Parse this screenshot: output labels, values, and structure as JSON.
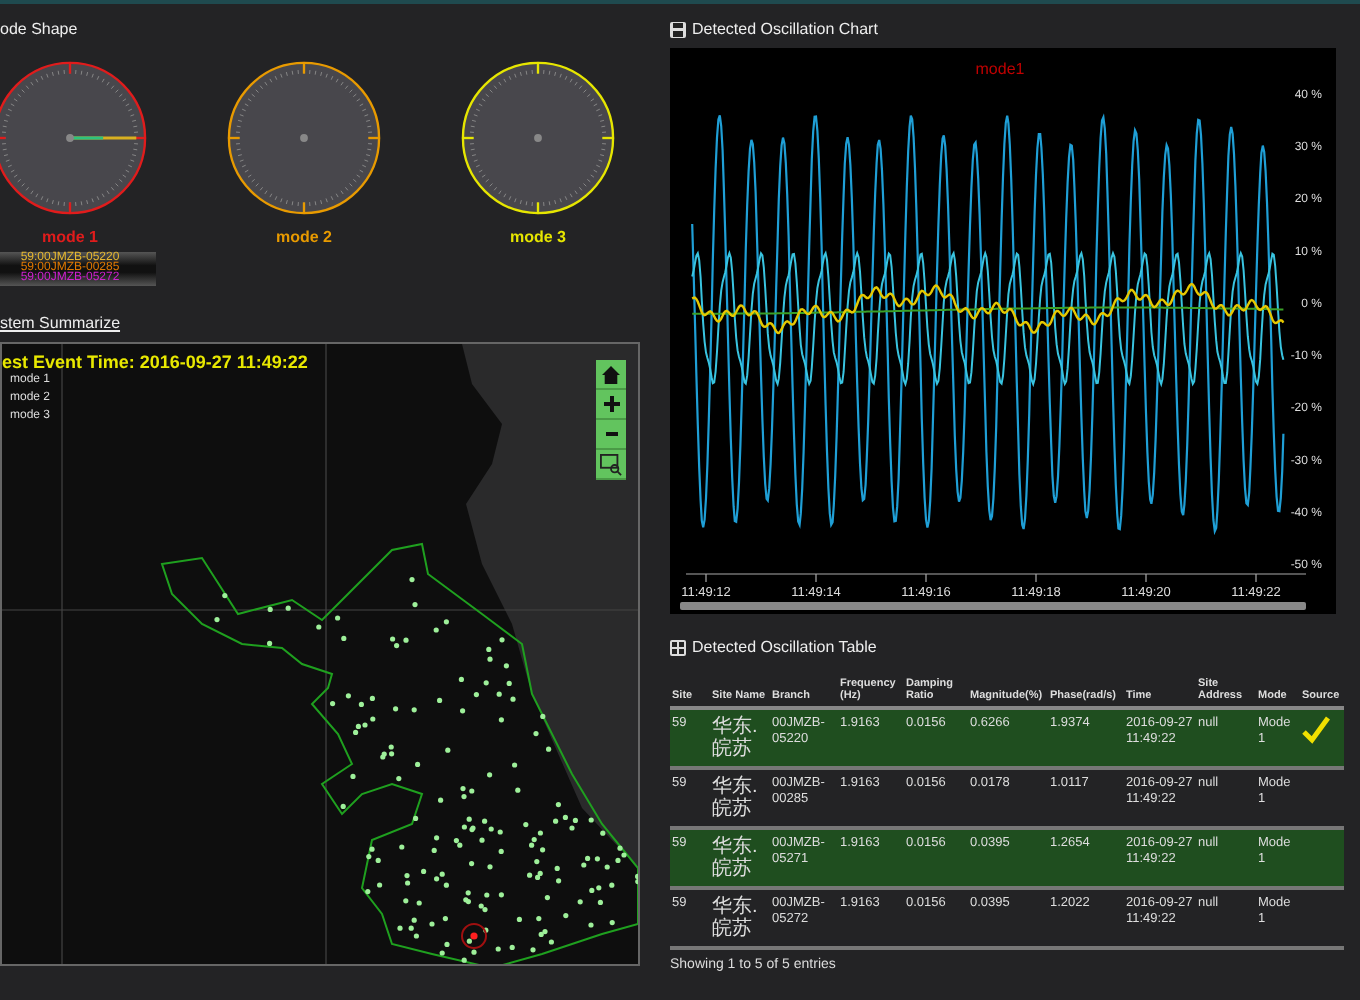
{
  "mode_shape": {
    "title": "ode Shape",
    "gauges": [
      {
        "label": "mode 1",
        "color": "#e01c1c",
        "needles": true
      },
      {
        "label": "mode 2",
        "color": "#e89a00",
        "needles": false
      },
      {
        "label": "mode 3",
        "color": "#e6e600",
        "needles": false
      }
    ],
    "legend": [
      {
        "label": "59:00JMZB-05220",
        "color": "#e8b830"
      },
      {
        "label": "59:00JMZB-00285",
        "color": "#e07800"
      },
      {
        "label": "59:00JMZB-05272",
        "color": "#d020d0"
      }
    ]
  },
  "system_summary": {
    "title": "stem Summarize",
    "event_time": "est Event Time: 2016-09-27 11:49:22",
    "legend": [
      "mode 1",
      "mode 2",
      "mode 3"
    ]
  },
  "chart": {
    "title": "Detected Oscillation Chart",
    "series_label": "mode1",
    "yticks": [
      "40 %",
      "30 %",
      "20 %",
      "10 %",
      "0 %",
      "-10 %",
      "-20 %",
      "-30 %",
      "-40 %",
      "-50 %"
    ],
    "xticks": [
      "11:49:12",
      "11:49:14",
      "11:49:16",
      "11:49:18",
      "11:49:20",
      "11:49:22"
    ]
  },
  "table": {
    "title": "Detected Oscillation Table",
    "columns": [
      "Site",
      "Site Name",
      "Branch",
      "Frequency (Hz)",
      "Damping Ratio",
      "Magnitude(%)",
      "Phase(rad/s)",
      "Time",
      "Site Address",
      "Mode",
      "Source"
    ],
    "rows": [
      {
        "highlighted": true,
        "source_checked": true,
        "cells": [
          "59",
          "华东.皖苏",
          "00JMZB-05220",
          "1.9163",
          "0.0156",
          "0.6266",
          "1.9374",
          "2016-09-27 11:49:22",
          "null",
          "Mode 1"
        ]
      },
      {
        "highlighted": false,
        "source_checked": false,
        "cells": [
          "59",
          "华东.皖苏",
          "00JMZB-00285",
          "1.9163",
          "0.0156",
          "0.0178",
          "1.0117",
          "2016-09-27 11:49:22",
          "null",
          "Mode 1"
        ]
      },
      {
        "highlighted": true,
        "source_checked": false,
        "cells": [
          "59",
          "华东.皖苏",
          "00JMZB-05271",
          "1.9163",
          "0.0156",
          "0.0395",
          "1.2654",
          "2016-09-27 11:49:22",
          "null",
          "Mode 1"
        ]
      },
      {
        "highlighted": false,
        "source_checked": false,
        "cells": [
          "59",
          "华东.皖苏",
          "00JMZB-05272",
          "1.9163",
          "0.0156",
          "0.0395",
          "1.2022",
          "2016-09-27 11:49:22",
          "null",
          "Mode 1"
        ]
      }
    ],
    "footer": "Showing 1 to 5 of 5 entries"
  }
}
